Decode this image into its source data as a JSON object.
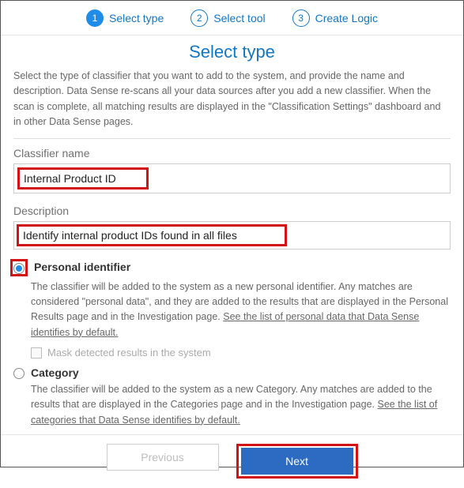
{
  "stepper": {
    "steps": [
      {
        "num": "1",
        "label": "Select type"
      },
      {
        "num": "2",
        "label": "Select tool"
      },
      {
        "num": "3",
        "label": "Create Logic"
      }
    ]
  },
  "page": {
    "title": "Select type",
    "intro": "Select the type of classifier that you want to add to the system, and provide the name and description. Data Sense re-scans all your data sources after you add a new classifier. When the scan is complete, all matching results are displayed in the \"Classification Settings\" dashboard and in other Data Sense pages."
  },
  "fields": {
    "name_label": "Classifier name",
    "name_value": "Internal Product ID",
    "desc_label": "Description",
    "desc_value": "Identify internal product IDs found in all files"
  },
  "options": {
    "personal": {
      "title": "Personal identifier",
      "desc_pre": "The classifier will be added to the system as a new personal identifier. Any matches are considered \"personal data\", and they are added to the results that are displayed in the Personal Results page and in the Investigation page. ",
      "desc_link": "See the list of personal data that Data Sense identifies by default.",
      "mask_label": "Mask detected results in the system"
    },
    "category": {
      "title": "Category",
      "desc_pre": "The classifier will be added to the system as a new Category. Any matches are added to the results that are displayed in the Categories page and in the Investigation page. ",
      "desc_link": "See the list of categories that Data Sense identifies by default."
    }
  },
  "footer": {
    "prev": "Previous",
    "next": "Next"
  }
}
